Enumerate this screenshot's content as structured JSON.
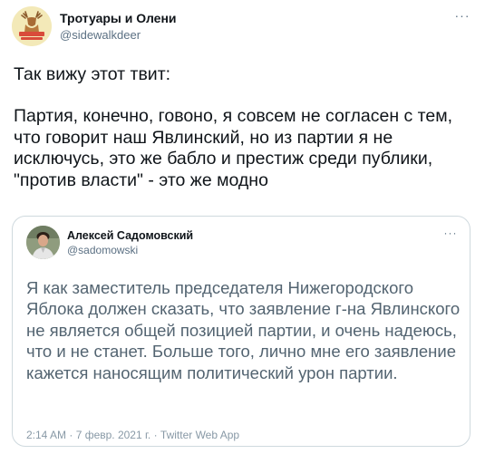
{
  "author": {
    "name": "Тротуары и Олени",
    "handle": "@sidewalkdeer",
    "avatar_icon": "deer-logo-icon"
  },
  "menu_icon": "more-dots-icon",
  "more_glyph": "···",
  "tweet_text": {
    "line1": "Так вижу этот твит:",
    "line2": "Партия, конечно, говоно, я совсем не согласен с тем, что говорит наш Явлинский, но из партии я не исключусь, это же бабло и престиж среди публики, \"против власти\" - это же модно"
  },
  "quoted_tweet": {
    "author_name": "Алексей Садомовский",
    "author_handle": "@sadomowski",
    "avatar_icon": "profile-photo-icon",
    "text": "Я как заместитель председателя Нижегородского Яблока должен сказать, что заявление г-на Явлинского не является общей позицией партии, и очень надеюсь, что и не станет. Больше того, лично мне его заявление кажется наносящим политический урон партии.",
    "meta": "2:14 AM · 7 февр. 2021 г. · Twitter Web App"
  },
  "colors": {
    "text_primary": "#0f1419",
    "text_secondary": "#5b7083",
    "quote_text": "#536471",
    "border": "#cfd9de"
  }
}
